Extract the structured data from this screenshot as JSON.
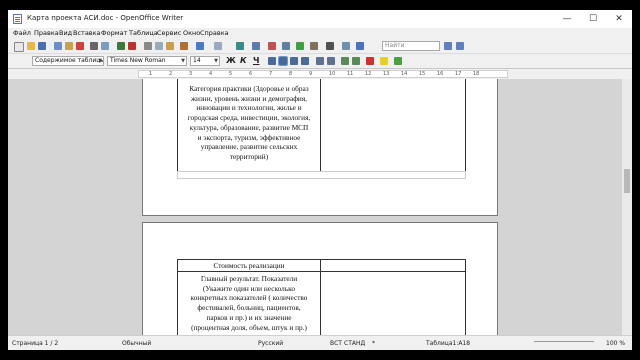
{
  "window": {
    "title": "Карта проекта АСИ.doc - OpenOffice Writer"
  },
  "window_controls": {
    "minimize": "—",
    "maximize": "☐",
    "close": "✕"
  },
  "menu": [
    "Файл",
    "Правка",
    "Вид",
    "Вставка",
    "Формат",
    "Таблица",
    "Сервис",
    "Окно",
    "Справка"
  ],
  "toolbar": {
    "search_placeholder": "Найти",
    "paragraph_style": "Содержимое таблицы",
    "font_name": "Times New Roman",
    "font_size": "14",
    "bold": "Ж",
    "italic": "К",
    "underline": "Ч",
    "icons": [
      "new-document-icon",
      "open-icon",
      "save-icon",
      "email-icon",
      "edit-icon",
      "export-pdf-icon",
      "print-icon",
      "print-preview-icon",
      "spellcheck-icon",
      "autospellcheck-icon",
      "cut-icon",
      "copy-icon",
      "paste-icon",
      "format-paintbrush-icon",
      "undo-icon",
      "redo-icon",
      "hyperlink-icon",
      "table-icon",
      "show-draw-icon",
      "navigator-icon",
      "gallery-icon",
      "datasource-icon",
      "nonprinting-chars-icon",
      "zoom-icon",
      "help-icon",
      "find-next-icon",
      "find-prev-icon",
      "align-left-icon",
      "align-center-icon",
      "align-right-icon",
      "justify-icon",
      "numbering-icon",
      "bullets-icon",
      "decrease-indent-icon",
      "increase-indent-icon",
      "font-color-icon",
      "highlight-icon",
      "background-color-icon"
    ]
  },
  "ruler": {
    "ticks": [
      "1",
      "2",
      "3",
      "4",
      "5",
      "6",
      "7",
      "8",
      "9",
      "10",
      "11",
      "12",
      "13",
      "14",
      "15",
      "16",
      "17",
      "18"
    ]
  },
  "document": {
    "page1_cell": "Категория практики (Здоровье и образ\nжизни, уровень жизни и демография,\nинновации и технологии, жилье и\nгородская среда, инвестиции, экология,\nкультура, образование, развитие МСП\nи экспорта, туризм, эффективное\nуправление, развитие сельских\nтерриторий)",
    "page2_row1": "Стоимость реализации",
    "page2_row2": "Главный результат. Показатели\n(Укажите один или несколько\nконкретных показателей ( количество\nфестивалей, больниц, пациентов,\nпарков и пр.) и их значение\n(процентная доля, объем, штук и пр.)\nназвание показателя и их значение или"
  },
  "status": {
    "page": "Страница 1 / 2",
    "style": "Обычный",
    "language": "Русский",
    "insert_mode": "ВСТ",
    "selection_mode": "СТАНД",
    "modified": "*",
    "table_cell": "Таблица1:A18",
    "zoom": "100 %"
  }
}
